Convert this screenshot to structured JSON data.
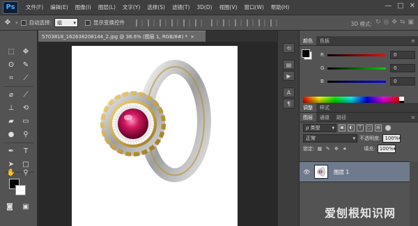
{
  "app": {
    "logo": "Ps"
  },
  "menu": [
    "文件(F)",
    "编辑(E)",
    "图像(I)",
    "图层(L)",
    "文字(Y)",
    "选择(S)",
    "滤镜(T)",
    "3D(D)",
    "视图(V)",
    "窗口(W)",
    "帮助(H)"
  ],
  "window_controls": {
    "minimize": "—",
    "maximize": "□",
    "close": "✕"
  },
  "options": {
    "auto_select_label": "自动选择:",
    "auto_select_value": "组",
    "show_transform_label": "显示变换控件",
    "mode_label": "3D 模式:"
  },
  "document": {
    "tab_title": "5703818_162638208144_2.jpg @ 38.6% (图层 1, RGB/8#) *",
    "close": "×"
  },
  "color_panel": {
    "tabs": [
      "颜色",
      "色板"
    ],
    "channels": [
      {
        "label": "R",
        "value": "0",
        "color": "#ff0000"
      },
      {
        "label": "G",
        "value": "0",
        "color": "#00b000"
      },
      {
        "label": "B",
        "value": "0",
        "color": "#0000ff"
      }
    ]
  },
  "adjust_tabs": [
    "调整",
    "样式"
  ],
  "layers_panel": {
    "tabs": [
      "图层",
      "通道",
      "路径"
    ],
    "kind_label": "ρ 类型",
    "blend_mode": "正常",
    "opacity_label": "不透明度:",
    "opacity_value": "100%",
    "lock_label": "锁定:",
    "fill_label": "填充:",
    "fill_value": "100%",
    "layer_name": "图层 1"
  },
  "watermark": "爱刨根知识网"
}
